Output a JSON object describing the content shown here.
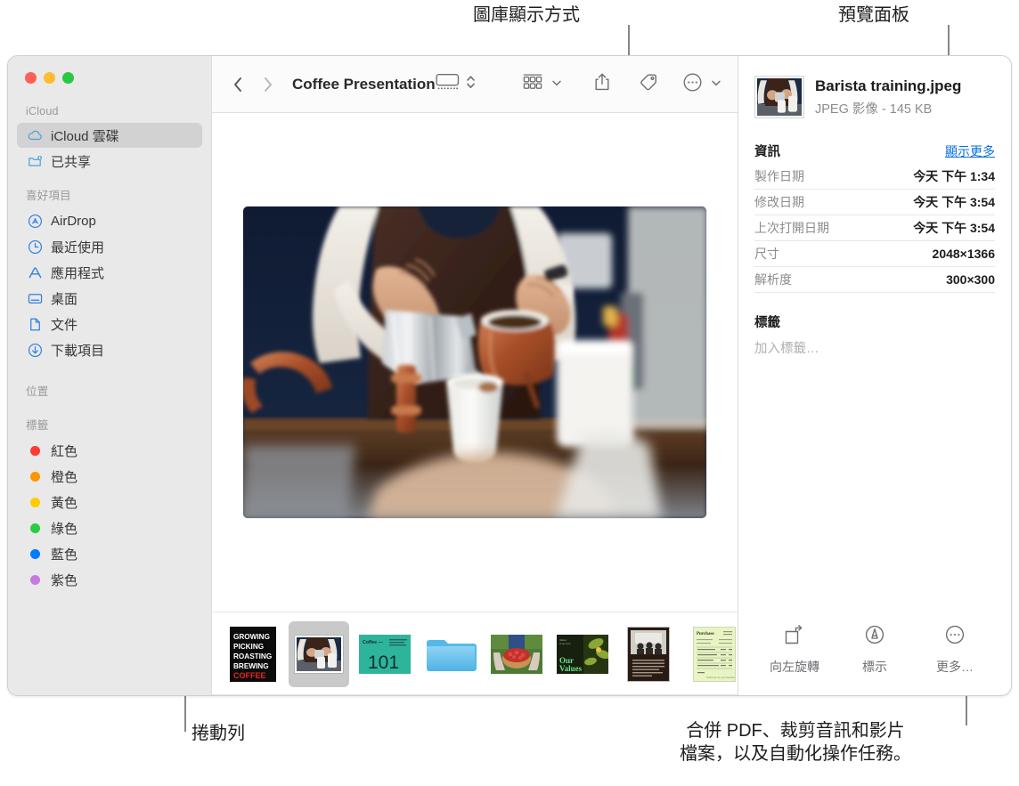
{
  "annotations": [
    {
      "id": "gallery-view",
      "text": "圖庫顯示方式"
    },
    {
      "id": "preview-panel",
      "text": "預覽面板"
    },
    {
      "id": "scroll-bar",
      "text": "捲動列"
    },
    {
      "id": "more-actions",
      "text": "合併 PDF、裁剪音訊和影片\n檔案，以及自動化操作任務。"
    }
  ],
  "window": {
    "traffic_lights": [
      {
        "name": "close",
        "color": "#ff5f57"
      },
      {
        "name": "minimize",
        "color": "#febc2e"
      },
      {
        "name": "zoom",
        "color": "#28c840"
      }
    ]
  },
  "sidebar": {
    "sections": [
      {
        "label": "iCloud",
        "items": [
          {
            "label": "iCloud 雲碟",
            "icon": "icloud-drive-icon",
            "selected": true
          },
          {
            "label": "已共享",
            "icon": "shared-folder-icon",
            "selected": false
          }
        ]
      },
      {
        "label": "喜好項目",
        "items": [
          {
            "label": "AirDrop",
            "icon": "airdrop-icon",
            "selected": false
          },
          {
            "label": "最近使用",
            "icon": "recents-clock-icon",
            "selected": false
          },
          {
            "label": "應用程式",
            "icon": "applications-icon",
            "selected": false
          },
          {
            "label": "桌面",
            "icon": "desktop-icon",
            "selected": false
          },
          {
            "label": "文件",
            "icon": "documents-icon",
            "selected": false
          },
          {
            "label": "下載項目",
            "icon": "downloads-icon",
            "selected": false
          }
        ]
      },
      {
        "label": "位置",
        "items": []
      },
      {
        "label": "標籤",
        "items": [
          {
            "label": "紅色",
            "icon": "tag-dot-icon",
            "color": "#ff3b30"
          },
          {
            "label": "橙色",
            "icon": "tag-dot-icon",
            "color": "#ff9500"
          },
          {
            "label": "黃色",
            "icon": "tag-dot-icon",
            "color": "#ffcc00"
          },
          {
            "label": "綠色",
            "icon": "tag-dot-icon",
            "color": "#28cd41"
          },
          {
            "label": "藍色",
            "icon": "tag-dot-icon",
            "color": "#007aff"
          },
          {
            "label": "紫色",
            "icon": "tag-dot-icon",
            "color": "#c77ae0"
          }
        ]
      }
    ]
  },
  "toolbar": {
    "back_label": "上一頁",
    "forward_label": "下一頁",
    "title": "Coffee Presentation",
    "buttons": [
      {
        "name": "gallery-view-button",
        "icon": "gallery-view-icon",
        "has_chevron": true
      },
      {
        "name": "group-by-button",
        "icon": "group-grid-icon",
        "has_chevron": true
      },
      {
        "name": "share-button",
        "icon": "share-icon",
        "has_chevron": false
      },
      {
        "name": "tag-button",
        "icon": "tag-icon",
        "has_chevron": false
      },
      {
        "name": "more-button",
        "icon": "ellipsis-circle-icon",
        "has_chevron": true
      },
      {
        "name": "search-button",
        "icon": "search-icon",
        "has_chevron": false
      }
    ]
  },
  "gallery": {
    "hero_alt": "barista-pouring-milk-photo"
  },
  "strip": {
    "thumbnails": [
      {
        "name": "thumb-coffee-poster",
        "kind": "poster",
        "lines": [
          "GROWING",
          "PICKING",
          "ROASTING",
          "BREWING"
        ],
        "accent_line": "COFFEE",
        "selected": false
      },
      {
        "name": "thumb-barista-training",
        "kind": "photo",
        "selected": true
      },
      {
        "name": "thumb-coffee-101",
        "kind": "slide",
        "title": "Coffee —",
        "big_text": "101",
        "selected": false
      },
      {
        "name": "thumb-folder",
        "kind": "folder",
        "selected": false
      },
      {
        "name": "thumb-berries-basket",
        "kind": "photo",
        "selected": false
      },
      {
        "name": "thumb-our-values",
        "kind": "slide",
        "big_text": "Our\nValues",
        "selected": false
      },
      {
        "name": "thumb-meeting-doc",
        "kind": "document",
        "selected": false
      },
      {
        "name": "thumb-invoice",
        "kind": "document",
        "title": "Purchase",
        "selected": false
      }
    ]
  },
  "preview": {
    "file_name": "Barista training.jpeg",
    "file_kind": "JPEG 影像 - 145 KB",
    "info_title": "資訊",
    "show_more_label": "顯示更多",
    "info_rows": [
      {
        "key": "製作日期",
        "value": "今天 下午 1:34"
      },
      {
        "key": "修改日期",
        "value": "今天 下午 3:54"
      },
      {
        "key": "上次打開日期",
        "value": "今天 下午 3:54"
      },
      {
        "key": "尺寸",
        "value": "2048×1366"
      },
      {
        "key": "解析度",
        "value": "300×300"
      }
    ],
    "tags_title": "標籤",
    "tags_placeholder": "加入標籤…",
    "actions": [
      {
        "name": "rotate-left-button",
        "icon": "rotate-left-icon",
        "label": "向左旋轉"
      },
      {
        "name": "markup-button",
        "icon": "markup-pen-icon",
        "label": "標示"
      },
      {
        "name": "more-actions-button",
        "icon": "ellipsis-circle-icon",
        "label": "更多…"
      }
    ]
  },
  "colors": {
    "accent_link": "#0a6fe0",
    "sidebar_bg": "#e9e9e9",
    "selection_bg": "#d2d2d2",
    "callout_line": "#86868b"
  }
}
